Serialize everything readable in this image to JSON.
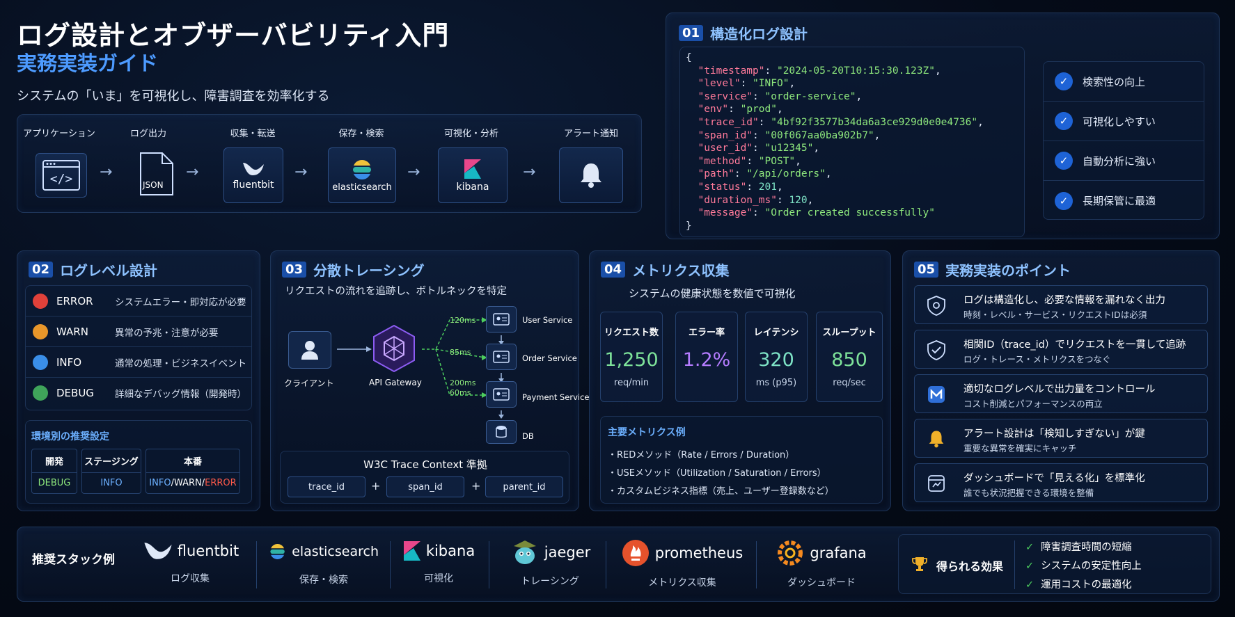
{
  "header": {
    "title": "ログ設計とオブザーバビリティ入門",
    "subtitle": "実務実装ガイド",
    "tagline": "システムの「いま」を可視化し、障害調査を効率化する"
  },
  "pipeline": {
    "steps": [
      {
        "label": "アプリケーション",
        "icon": "code-window-icon",
        "text": ""
      },
      {
        "label": "ログ出力",
        "icon": "json-file-icon",
        "text": "JSON"
      },
      {
        "label": "収集・転送",
        "icon": "fluentbit-bird-icon",
        "text": "fluentbit"
      },
      {
        "label": "保存・検索",
        "icon": "elasticsearch-icon",
        "text": "elasticsearch"
      },
      {
        "label": "可視化・分析",
        "icon": "kibana-icon",
        "text": "kibana"
      },
      {
        "label": "アラート通知",
        "icon": "bell-icon",
        "text": ""
      }
    ]
  },
  "structured_log": {
    "number": "01",
    "title": "構造化ログ設計",
    "lines": [
      {
        "key": "timestamp",
        "value": "\"2024-05-20T10:15:30.123Z\"",
        "type": "s"
      },
      {
        "key": "level",
        "value": "\"INFO\"",
        "type": "s"
      },
      {
        "key": "service",
        "value": "\"order-service\"",
        "type": "s"
      },
      {
        "key": "env",
        "value": "\"prod\"",
        "type": "s"
      },
      {
        "key": "trace_id",
        "value": "\"4bf92f3577b34da6a3ce929d0e0e4736\"",
        "type": "s"
      },
      {
        "key": "span_id",
        "value": "\"00f067aa0ba902b7\"",
        "type": "s"
      },
      {
        "key": "user_id",
        "value": "\"u12345\"",
        "type": "s"
      },
      {
        "key": "method",
        "value": "\"POST\"",
        "type": "s"
      },
      {
        "key": "path",
        "value": "\"/api/orders\"",
        "type": "s"
      },
      {
        "key": "status",
        "value": "201",
        "type": "n"
      },
      {
        "key": "duration_ms",
        "value": "120",
        "type": "n"
      },
      {
        "key": "message",
        "value": "\"Order created successfully\"",
        "type": "s"
      }
    ],
    "benefits": [
      "検索性の向上",
      "可視化しやすい",
      "自動分析に強い",
      "長期保管に最適"
    ]
  },
  "log_levels": {
    "number": "02",
    "title": "ログレベル設計",
    "levels": [
      {
        "name": "ERROR",
        "desc": "システムエラー・即対応が必要",
        "color": "#e0413a"
      },
      {
        "name": "WARN",
        "desc": "異常の予兆・注意が必要",
        "color": "#e8962a"
      },
      {
        "name": "INFO",
        "desc": "通常の処理・ビジネスイベント",
        "color": "#3a8ee8"
      },
      {
        "name": "DEBUG",
        "desc": "詳細なデバッグ情報（開発時）",
        "color": "#3fa45a"
      }
    ],
    "env_title": "環境別の推奨設定",
    "envs": [
      {
        "name": "開発",
        "value": "DEBUG"
      },
      {
        "name": "ステージング",
        "value": "INFO"
      },
      {
        "name": "本番",
        "value_parts": [
          "INFO",
          "/",
          "WARN",
          "/",
          "ERROR"
        ]
      }
    ]
  },
  "tracing": {
    "number": "03",
    "title": "分散トレーシング",
    "desc": "リクエストの流れを追跡し、ボトルネックを特定",
    "client_label": "クライアント",
    "gateway_label": "API Gateway",
    "services": [
      "User Service",
      "Order Service",
      "Payment Service",
      "DB"
    ],
    "timings": [
      "120ms",
      "85ms",
      "200ms",
      "60ms"
    ],
    "context_title": "W3C Trace Context 準拠",
    "context_fields": [
      "trace_id",
      "span_id",
      "parent_id"
    ],
    "plus": "+"
  },
  "metrics": {
    "number": "04",
    "title": "メトリクス収集",
    "desc": "システムの健康状態を数値で可視化",
    "cards": [
      {
        "label": "リクエスト数",
        "value": "1,250",
        "unit": "req/min",
        "color": "#7ee39a"
      },
      {
        "label": "エラー率",
        "value": "1.2%",
        "unit": "",
        "color": "#b57cff"
      },
      {
        "label": "レイテンシ",
        "value": "320",
        "unit": "ms (p95)",
        "color": "#7ee3c6"
      },
      {
        "label": "スループット",
        "value": "850",
        "unit": "req/sec",
        "color": "#7ee39a"
      }
    ],
    "examples_title": "主要メトリクス例",
    "examples": [
      "・REDメソッド（Rate / Errors / Duration）",
      "・USEメソッド（Utilization / Saturation / Errors）",
      "・カスタムビジネス指標（売上、ユーザー登録数など）"
    ]
  },
  "points": {
    "number": "05",
    "title": "実務実装のポイント",
    "items": [
      {
        "main": "ログは構造化し、必要な情報を漏れなく出力",
        "sub": "時刻・レベル・サービス・リクエストIDは必須",
        "icon": "gear-shield-icon"
      },
      {
        "main": "相関ID（trace_id）でリクエストを一貫して追跡",
        "sub": "ログ・トレース・メトリクスをつなぐ",
        "icon": "shield-check-icon"
      },
      {
        "main": "適切なログレベルで出力量をコントロール",
        "sub": "コスト削減とパフォーマンスの両立",
        "icon": "level-control-icon"
      },
      {
        "main": "アラート設計は「検知しすぎない」が鍵",
        "sub": "重要な異常を確実にキャッチ",
        "icon": "bell-icon"
      },
      {
        "main": "ダッシュボードで「見える化」を標準化",
        "sub": "誰でも状況把握できる環境を整備",
        "icon": "dashboard-icon"
      }
    ]
  },
  "stack": {
    "title": "推奨スタック例",
    "items": [
      {
        "brand": "fluentbit",
        "role": "ログ収集",
        "icon": "fluentbit-bird-icon"
      },
      {
        "brand": "elasticsearch",
        "role": "保存・検索",
        "icon": "elasticsearch-icon"
      },
      {
        "brand": "kibana",
        "role": "可視化",
        "icon": "kibana-icon"
      },
      {
        "brand": "jaeger",
        "role": "トレーシング",
        "icon": "jaeger-icon"
      },
      {
        "brand": "prometheus",
        "role": "メトリクス収集",
        "icon": "prometheus-icon"
      },
      {
        "brand": "grafana",
        "role": "ダッシュボード",
        "icon": "grafana-icon"
      }
    ],
    "effects_title": "得られる効果",
    "effects": [
      "障害調査時間の短縮",
      "システムの安定性向上",
      "運用コストの最適化"
    ]
  }
}
